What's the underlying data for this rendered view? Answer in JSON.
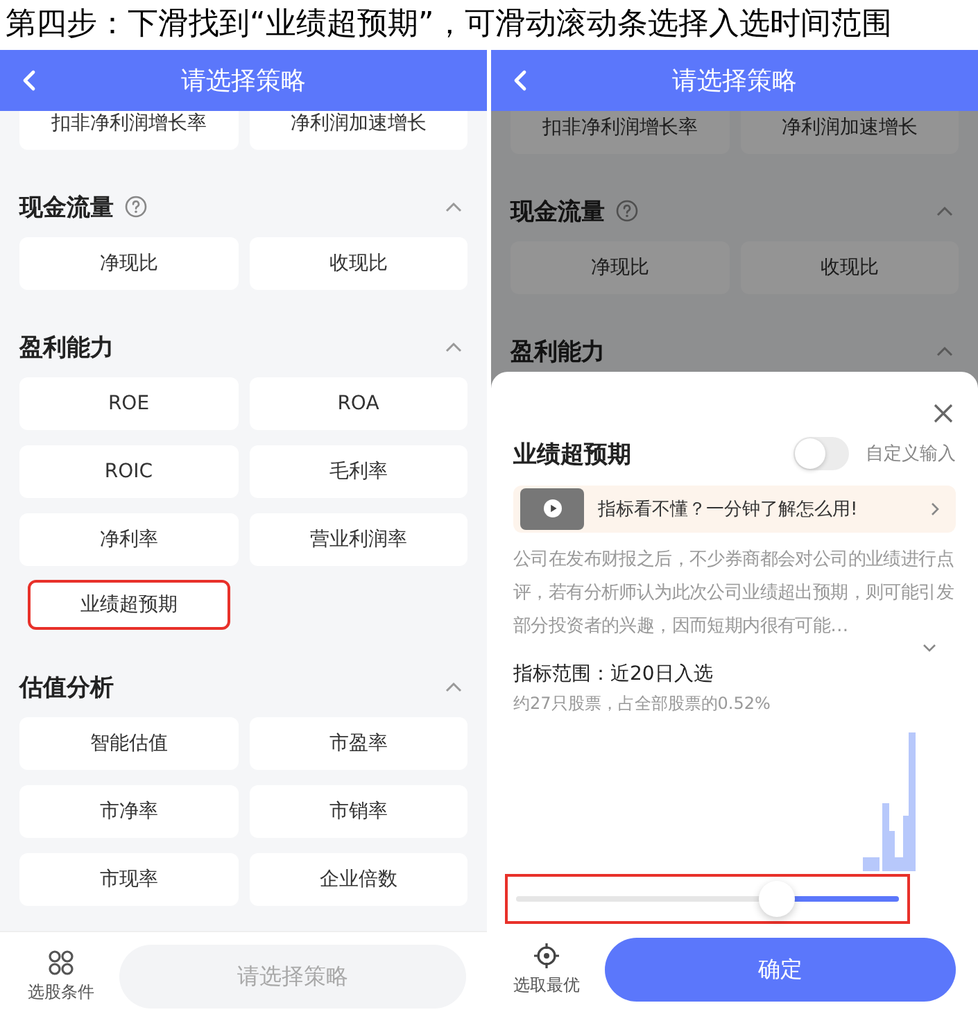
{
  "caption": "第四步：下滑找到“业绩超预期”，可滑动滚动条选择入选时间范围",
  "left_screen": {
    "header": {
      "title": "请选择策略"
    },
    "partial_items": [
      {
        "label": "扣非净利润增长率",
        "highlighted": false
      },
      {
        "label": "净利润加速增长",
        "highlighted": false
      }
    ],
    "sections": [
      {
        "title": "现金流量",
        "help": true,
        "expanded": true,
        "items": [
          {
            "label": "净现比",
            "highlighted": false
          },
          {
            "label": "收现比",
            "highlighted": false
          }
        ]
      },
      {
        "title": "盈利能力",
        "help": false,
        "expanded": true,
        "items": [
          {
            "label": "ROE",
            "highlighted": false
          },
          {
            "label": "ROA",
            "highlighted": false
          },
          {
            "label": "ROIC",
            "highlighted": false
          },
          {
            "label": "毛利率",
            "highlighted": false
          },
          {
            "label": "净利率",
            "highlighted": false
          },
          {
            "label": "营业利润率",
            "highlighted": false
          },
          {
            "label": "业绩超预期",
            "highlighted": true
          }
        ]
      },
      {
        "title": "估值分析",
        "help": false,
        "expanded": true,
        "items": [
          {
            "label": "智能估值",
            "highlighted": false
          },
          {
            "label": "市盈率",
            "highlighted": false
          },
          {
            "label": "市净率",
            "highlighted": false
          },
          {
            "label": "市销率",
            "highlighted": false
          },
          {
            "label": "市现率",
            "highlighted": false
          },
          {
            "label": "企业倍数",
            "highlighted": false
          }
        ]
      }
    ],
    "bottom_bar": {
      "conditions_label": "选股条件",
      "strategy_button": {
        "label": "请选择策略",
        "disabled": true
      }
    }
  },
  "right_screen": {
    "header": {
      "title": "请选择策略"
    },
    "partial_items": [
      {
        "label": "扣非净利润增长率",
        "highlighted": false
      },
      {
        "label": "净利润加速增长",
        "highlighted": false
      }
    ],
    "sections": [
      {
        "title": "现金流量",
        "help": true,
        "expanded": true,
        "items": [
          {
            "label": "净现比",
            "highlighted": false
          },
          {
            "label": "收现比",
            "highlighted": false
          }
        ]
      },
      {
        "title": "盈利能力",
        "help": false,
        "expanded": true
      }
    ],
    "sheet": {
      "title": "业绩超预期",
      "custom_input": {
        "label": "自定义输入",
        "on": false
      },
      "video_banner": {
        "text": "指标看不懂？一分钟了解怎么用!"
      },
      "description": "公司在发布财报之后，不少券商都会对公司的业绩进行点评，若有分析师认为此次公司业绩超出预期，则可能引发部分投资者的兴趣，因而短期内很有可能…",
      "range_label": "指标范围：近20日入选",
      "stock_note": "约27只股票，占全部股票的0.52%",
      "slider": {
        "level": 0.68,
        "highlighted": true
      },
      "best_pick_label": "选取最优",
      "confirm_button": "确定"
    }
  }
}
